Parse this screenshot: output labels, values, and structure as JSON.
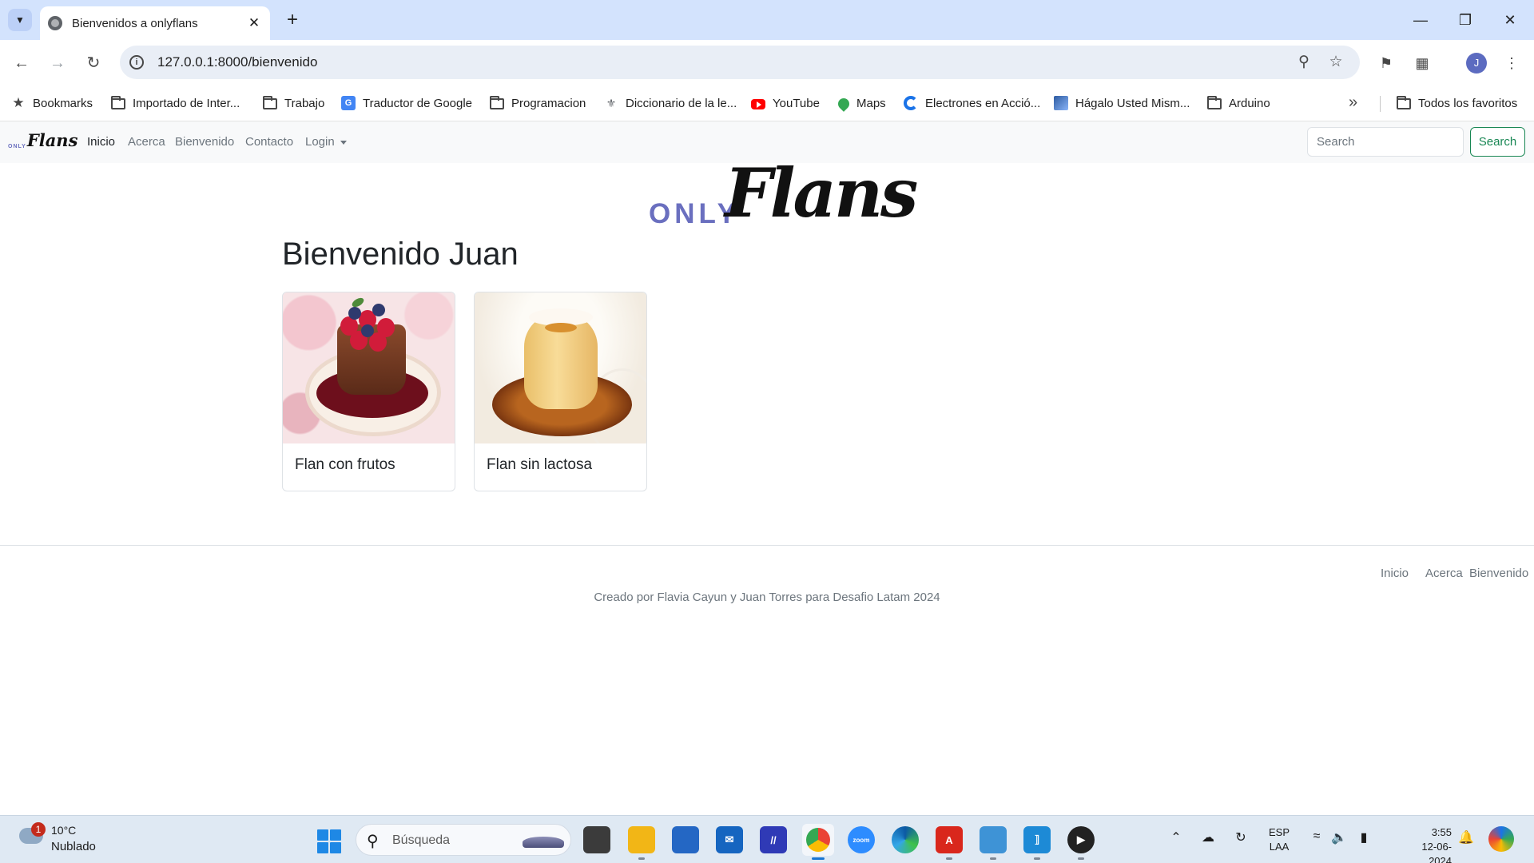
{
  "browser": {
    "tab_title": "Bienvenidos a onlyflans",
    "url": "127.0.0.1:8000/bienvenido",
    "bookmarks": [
      {
        "label": "Bookmarks",
        "icon": "star-icon"
      },
      {
        "label": "Importado de Inter...",
        "icon": "folder-icon"
      },
      {
        "label": "Trabajo",
        "icon": "folder-icon"
      },
      {
        "label": "Traductor de Google",
        "icon": "google-translate-icon"
      },
      {
        "label": "Programacion",
        "icon": "folder-icon"
      },
      {
        "label": "Diccionario de la le...",
        "icon": "rae-icon"
      },
      {
        "label": "YouTube",
        "icon": "youtube-icon"
      },
      {
        "label": "Maps",
        "icon": "maps-icon"
      },
      {
        "label": "Electrones en Acció...",
        "icon": "c-logo-icon"
      },
      {
        "label": "Hágalo Usted Mism...",
        "icon": "site-icon"
      },
      {
        "label": "Arduino",
        "icon": "folder-icon"
      }
    ],
    "all_bookmarks": "Todos los favoritos",
    "profile_initial": "J"
  },
  "site": {
    "brand_only": "ONLY",
    "brand_flans": "Flans",
    "nav": {
      "inicio": "Inicio",
      "acerca": "Acerca",
      "bienvenido": "Bienvenido",
      "contacto": "Contacto",
      "login": "Login"
    },
    "search_placeholder": "Search",
    "search_button": "Search"
  },
  "main": {
    "hero_only": "ONLY",
    "hero_flans": "Flans",
    "heading": "Bienvenido Juan",
    "cards": [
      {
        "title": "Flan con frutos"
      },
      {
        "title": "Flan sin lactosa"
      }
    ]
  },
  "footer": {
    "links": [
      "Inicio",
      "Acerca",
      "Bienvenido"
    ],
    "credit": "Creado por Flavia Cayun y Juan Torres para Desafio Latam 2024"
  },
  "taskbar": {
    "weather_badge": "1",
    "weather_temp": "10°C",
    "weather_desc": "Nublado",
    "search_placeholder": "Búsqueda",
    "lang_line1": "ESP",
    "lang_line2": "LAA",
    "time": "3:55",
    "date": "12-06-2024"
  },
  "colors": {
    "brand_accent": "#6a6fbf",
    "search_button": "#198754",
    "navbar_bg": "#f8f9fa",
    "tabstrip_bg": "#d3e3fd"
  }
}
